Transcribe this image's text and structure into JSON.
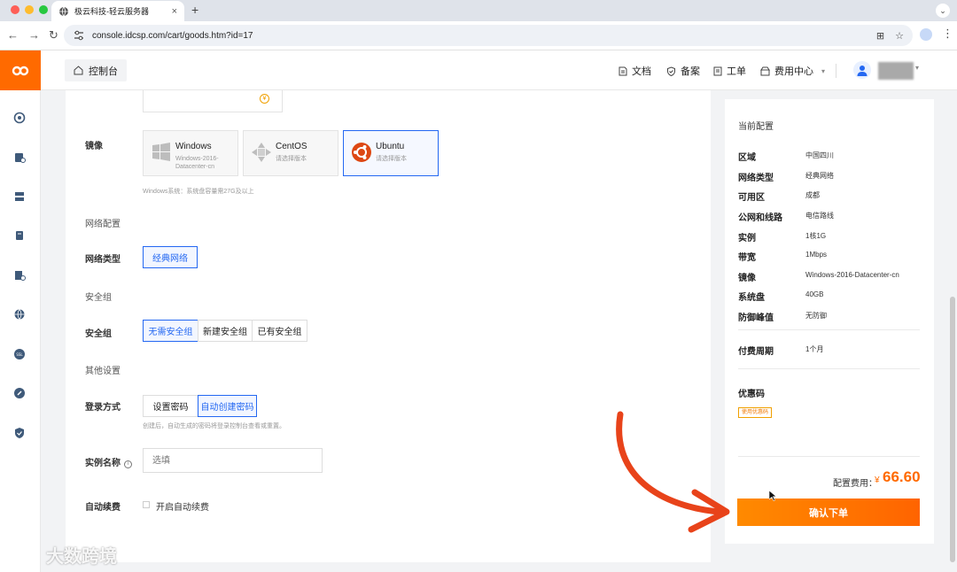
{
  "browser": {
    "tab_title": "极云科技-轻云服务器",
    "url": "console.idcsp.com/cart/goods.htm?id=17"
  },
  "header": {
    "console_label": "控制台",
    "nav": [
      "文档",
      "备案",
      "工单",
      "费用中心"
    ]
  },
  "form": {
    "image_label": "镜像",
    "images": [
      {
        "name": "Windows",
        "sub": "Windows-2016-Datacenter-cn"
      },
      {
        "name": "CentOS",
        "sub": "请选择版本"
      },
      {
        "name": "Ubuntu",
        "sub": "请选择版本"
      }
    ],
    "windows_hint": "Windows系统：系统盘容量需27G及以上",
    "network_section": "网络配置",
    "network_type_label": "网络类型",
    "network_type_option": "经典网络",
    "security_section": "安全组",
    "security_label": "安全组",
    "security_options": [
      "无需安全组",
      "新建安全组",
      "已有安全组"
    ],
    "other_section": "其他设置",
    "login_label": "登录方式",
    "login_options": [
      "设置密码",
      "自动创建密码"
    ],
    "login_hint": "创建后，自动生成的密码将登录控制台查看或重置。",
    "instance_name_label": "实例名称",
    "instance_name_placeholder": "选填",
    "auto_renew_label": "自动续费",
    "auto_renew_option": "开启自动续费"
  },
  "summary": {
    "title": "当前配置",
    "rows": [
      {
        "k": "区域",
        "v": "中国四川"
      },
      {
        "k": "网络类型",
        "v": "经典网络"
      },
      {
        "k": "可用区",
        "v": "成都"
      },
      {
        "k": "公网和线路",
        "v": "电信路线"
      },
      {
        "k": "实例",
        "v": "1核1G"
      },
      {
        "k": "带宽",
        "v": "1Mbps"
      },
      {
        "k": "镜像",
        "v": "Windows-2016-Datacenter-cn"
      },
      {
        "k": "系统盘",
        "v": "40GB"
      },
      {
        "k": "防御峰值",
        "v": "无防御"
      }
    ],
    "period_label": "付费周期",
    "period_value": "1个月",
    "coupon_title": "优惠码",
    "coupon_tag": "使用优惠码",
    "cost_label": "配置费用：",
    "currency": "¥",
    "cost_value": "66.60",
    "order_button": "确认下单"
  },
  "watermark": "大数跨境",
  "colors": {
    "accent": "#ff6a00",
    "selected": "#2468f2"
  }
}
